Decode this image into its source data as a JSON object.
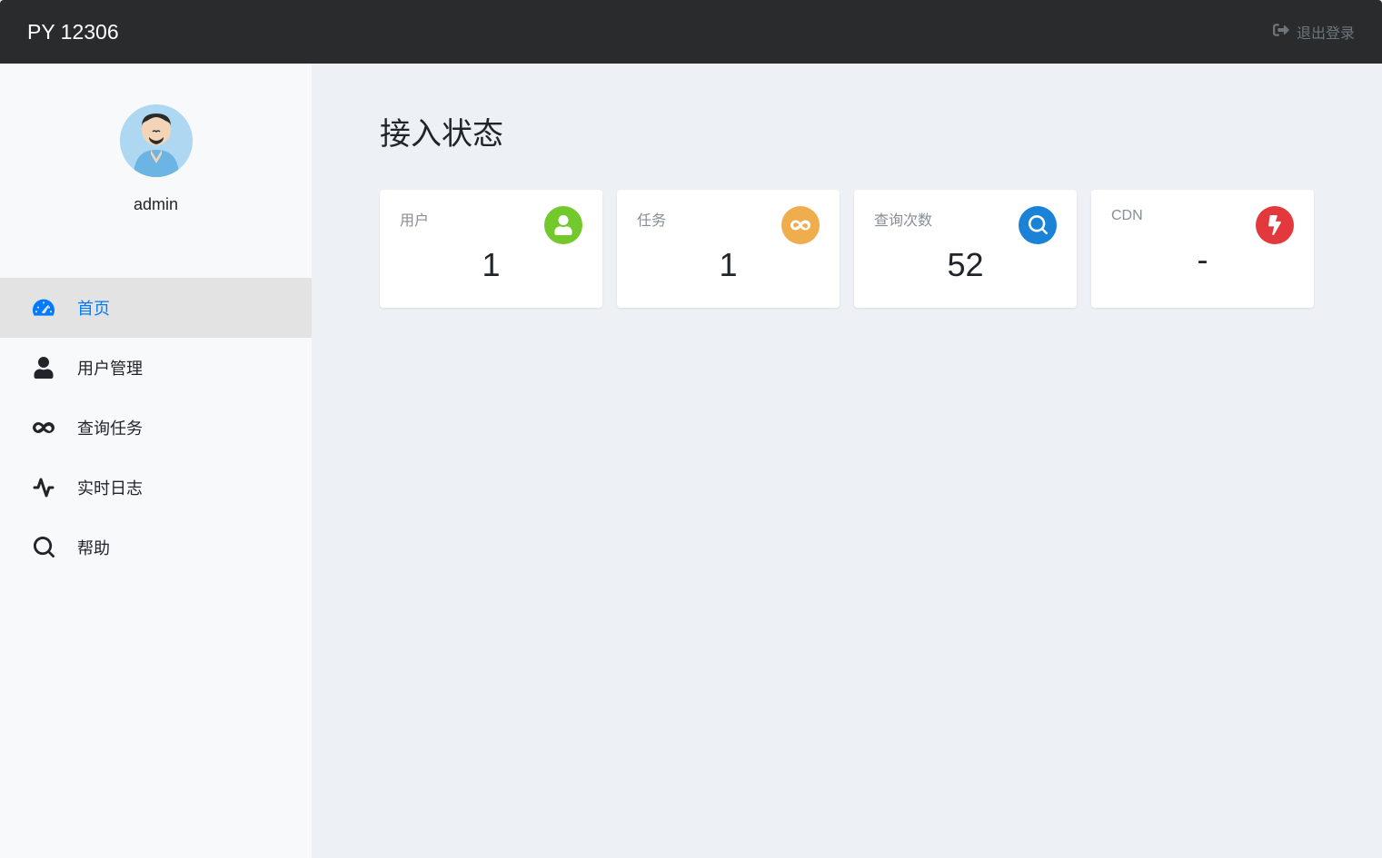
{
  "header": {
    "brand": "PY 12306",
    "logout_label": "退出登录"
  },
  "sidebar": {
    "username": "admin",
    "items": [
      {
        "label": "首页",
        "icon": "dashboard",
        "active": true
      },
      {
        "label": "用户管理",
        "icon": "user",
        "active": false
      },
      {
        "label": "查询任务",
        "icon": "infinity",
        "active": false
      },
      {
        "label": "实时日志",
        "icon": "activity",
        "active": false
      },
      {
        "label": "帮助",
        "icon": "search",
        "active": false
      }
    ]
  },
  "main": {
    "title": "接入状态",
    "cards": [
      {
        "label": "用户",
        "value": "1",
        "icon": "user",
        "color": "green"
      },
      {
        "label": "任务",
        "value": "1",
        "icon": "infinity",
        "color": "orange"
      },
      {
        "label": "查询次数",
        "value": "52",
        "icon": "search",
        "color": "blue"
      },
      {
        "label": "CDN",
        "value": "-",
        "icon": "bolt",
        "color": "red"
      }
    ]
  }
}
